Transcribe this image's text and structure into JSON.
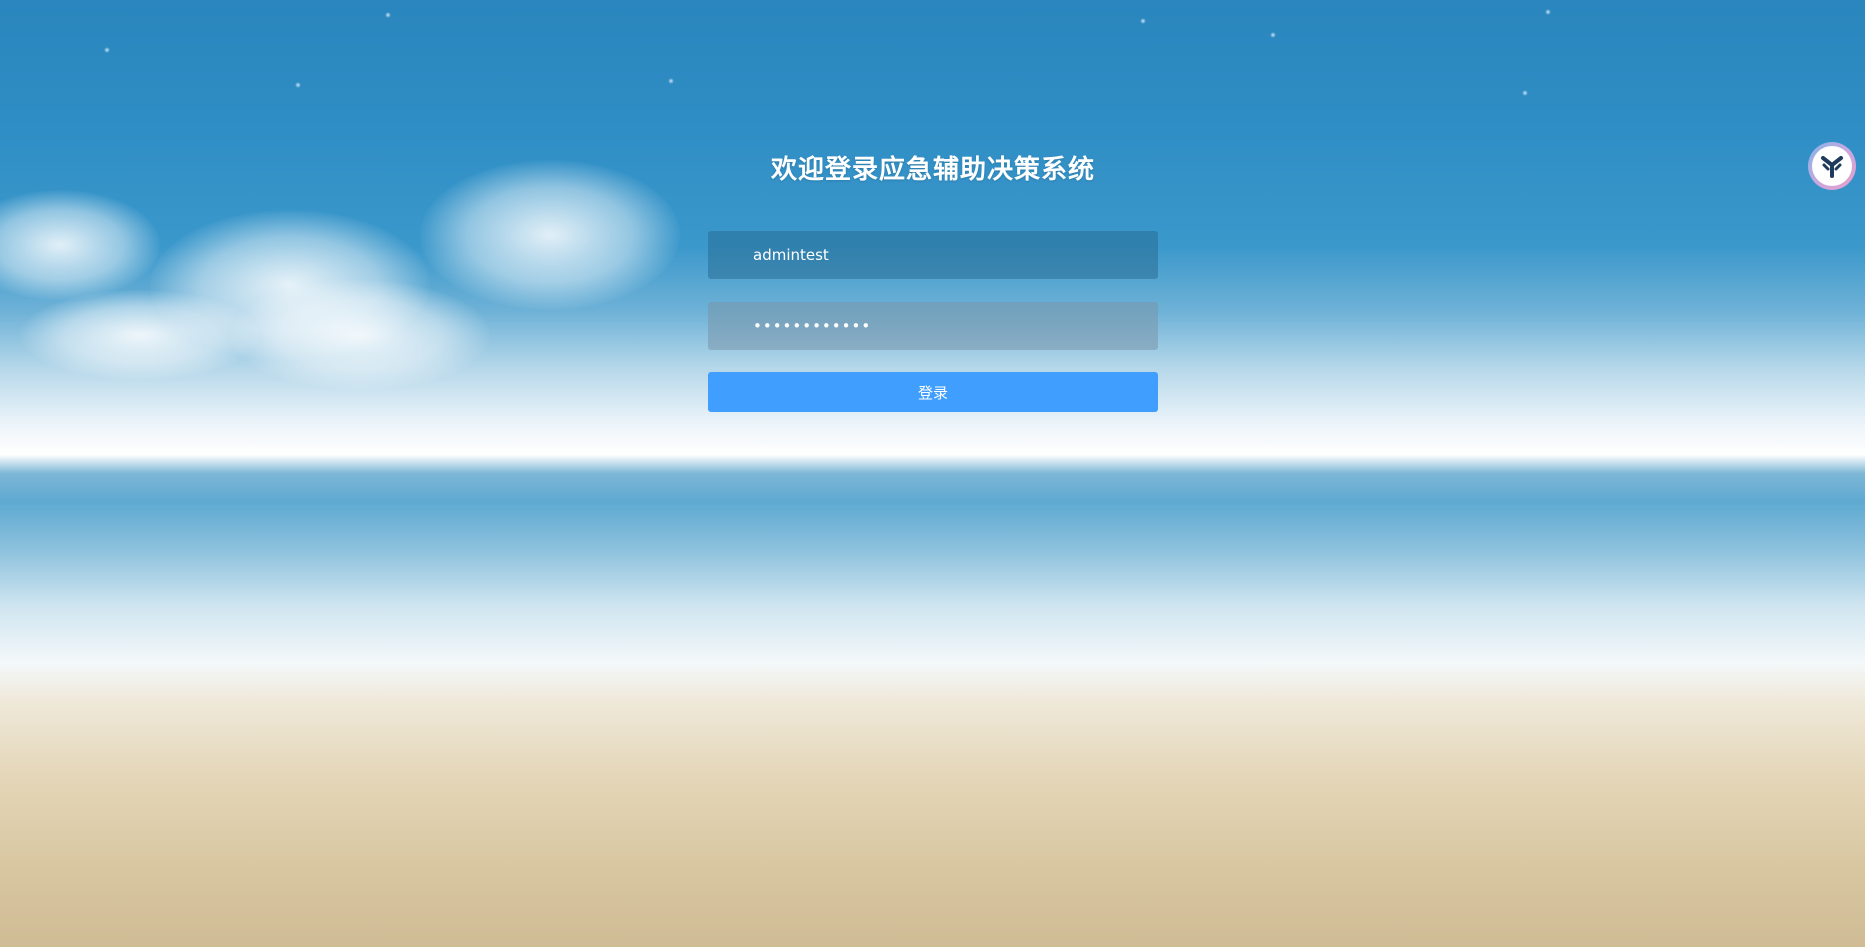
{
  "login": {
    "title": "欢迎登录应急辅助决策系统",
    "username_value": "admintest",
    "password_value": "adminpass123",
    "submit_label": "登录"
  },
  "widgets": {
    "assistant_icon": "assistant-logo-icon"
  },
  "colors": {
    "button": "#409eff",
    "sky": "#2a86bd",
    "sand": "#d8c6a0"
  }
}
